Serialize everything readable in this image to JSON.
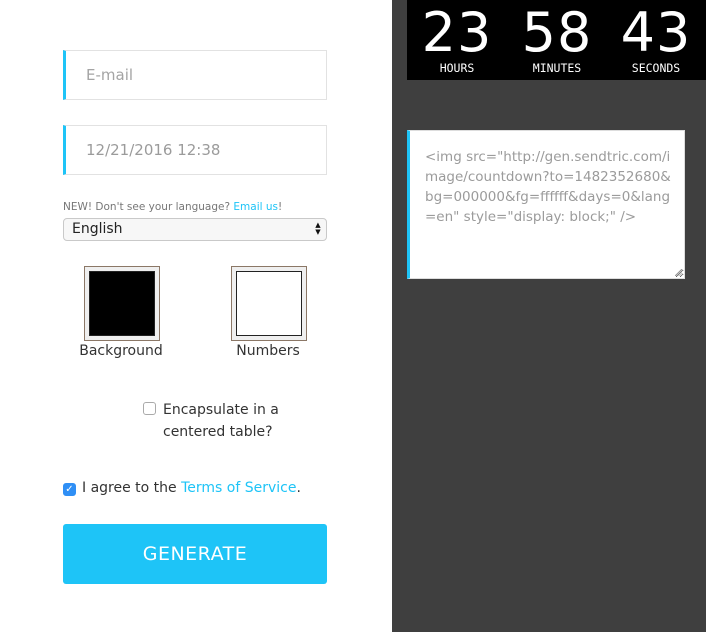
{
  "form": {
    "email_placeholder": "E-mail",
    "datetime_value": "12/21/2016 12:38",
    "language_note": {
      "prefix": "NEW! Don't see your language? ",
      "link": "Email us",
      "suffix": "!"
    },
    "language_selected": "English",
    "colors": {
      "background": {
        "label": "Background",
        "value": "#000000"
      },
      "numbers": {
        "label": "Numbers",
        "value": "#ffffff"
      }
    },
    "encapsulate": {
      "label": "Encapsulate in a centered table?",
      "checked": false
    },
    "agree": {
      "prefix": "I agree to the ",
      "link": "Terms of Service",
      "suffix": ".",
      "checked": true
    },
    "generate_label": "GENERATE"
  },
  "countdown": {
    "hours": {
      "value": "23",
      "label": "HOURS"
    },
    "minutes": {
      "value": "58",
      "label": "MINUTES"
    },
    "seconds": {
      "value": "43",
      "label": "SECONDS"
    }
  },
  "embed_code": "<img src=\"http://gen.sendtric.com/image/countdown?to=1482352680&bg=000000&fg=ffffff&days=0&lang=en\" style=\"display: block;\" />",
  "theme": {
    "accent": "#1ec4f7",
    "panel_dark": "#3f3f3f",
    "checkbox_checked": "#2f8ff5"
  }
}
